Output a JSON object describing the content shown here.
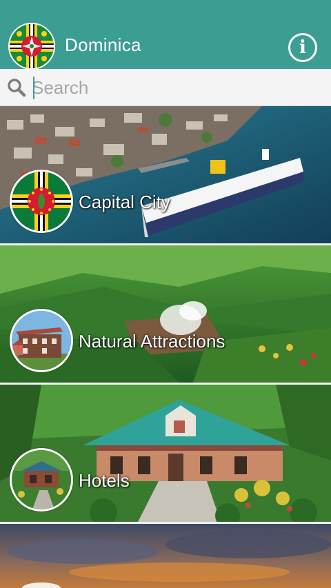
{
  "app_bar": {
    "title": "Dominica",
    "info_label": "i",
    "color": "#3c9e93"
  },
  "search": {
    "placeholder": "Search",
    "value": ""
  },
  "categories": [
    {
      "label": "Capital City",
      "icon": "dominica-flag-thumbnail"
    },
    {
      "label": "Natural Attractions",
      "icon": "historic-building-thumbnail"
    },
    {
      "label": "Hotels",
      "icon": "hotel-cottage-thumbnail"
    }
  ],
  "colors": {
    "flag_green": "#0a7a3a",
    "flag_yellow": "#fcd116",
    "flag_red": "#d41c30",
    "sea": "#1e6f8a",
    "forest": "#2f7a2a"
  }
}
